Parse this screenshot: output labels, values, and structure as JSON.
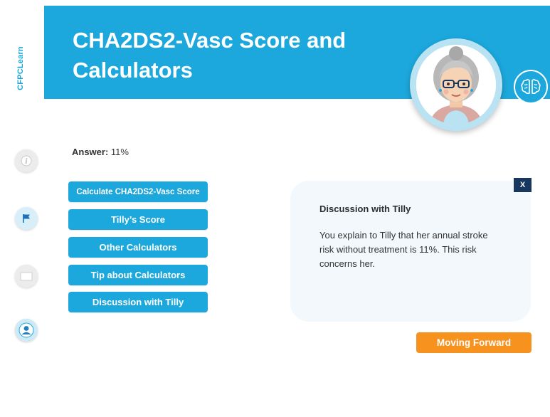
{
  "brand": {
    "name": "CFPCLearn"
  },
  "header": {
    "title_line1": "CHA2DS2-Vasc Score and",
    "title_line2": "Calculators"
  },
  "rail": {
    "items": [
      {
        "icon": "info-icon"
      },
      {
        "icon": "flag-icon"
      },
      {
        "icon": "folder-icon"
      },
      {
        "icon": "user-icon"
      }
    ]
  },
  "answer": {
    "label": "Answer:",
    "value": "11%"
  },
  "buttons": [
    {
      "label": "Calculate CHA2DS2-Vasc Score"
    },
    {
      "label": "Tilly’s Score"
    },
    {
      "label": "Other Calculators"
    },
    {
      "label": "Tip about Calculators"
    },
    {
      "label": "Discussion with Tilly"
    }
  ],
  "discussion": {
    "title": "Discussion with Tilly",
    "body": "You explain to Tilly that her annual stroke risk without treatment is 11%. This risk concerns her.",
    "close_label": "X"
  },
  "next_button": {
    "label": "Moving Forward"
  },
  "colors": {
    "primary": "#1ca8dc",
    "accent": "#f7921e",
    "close": "#17375e",
    "card_bg": "#f2f8fc"
  }
}
